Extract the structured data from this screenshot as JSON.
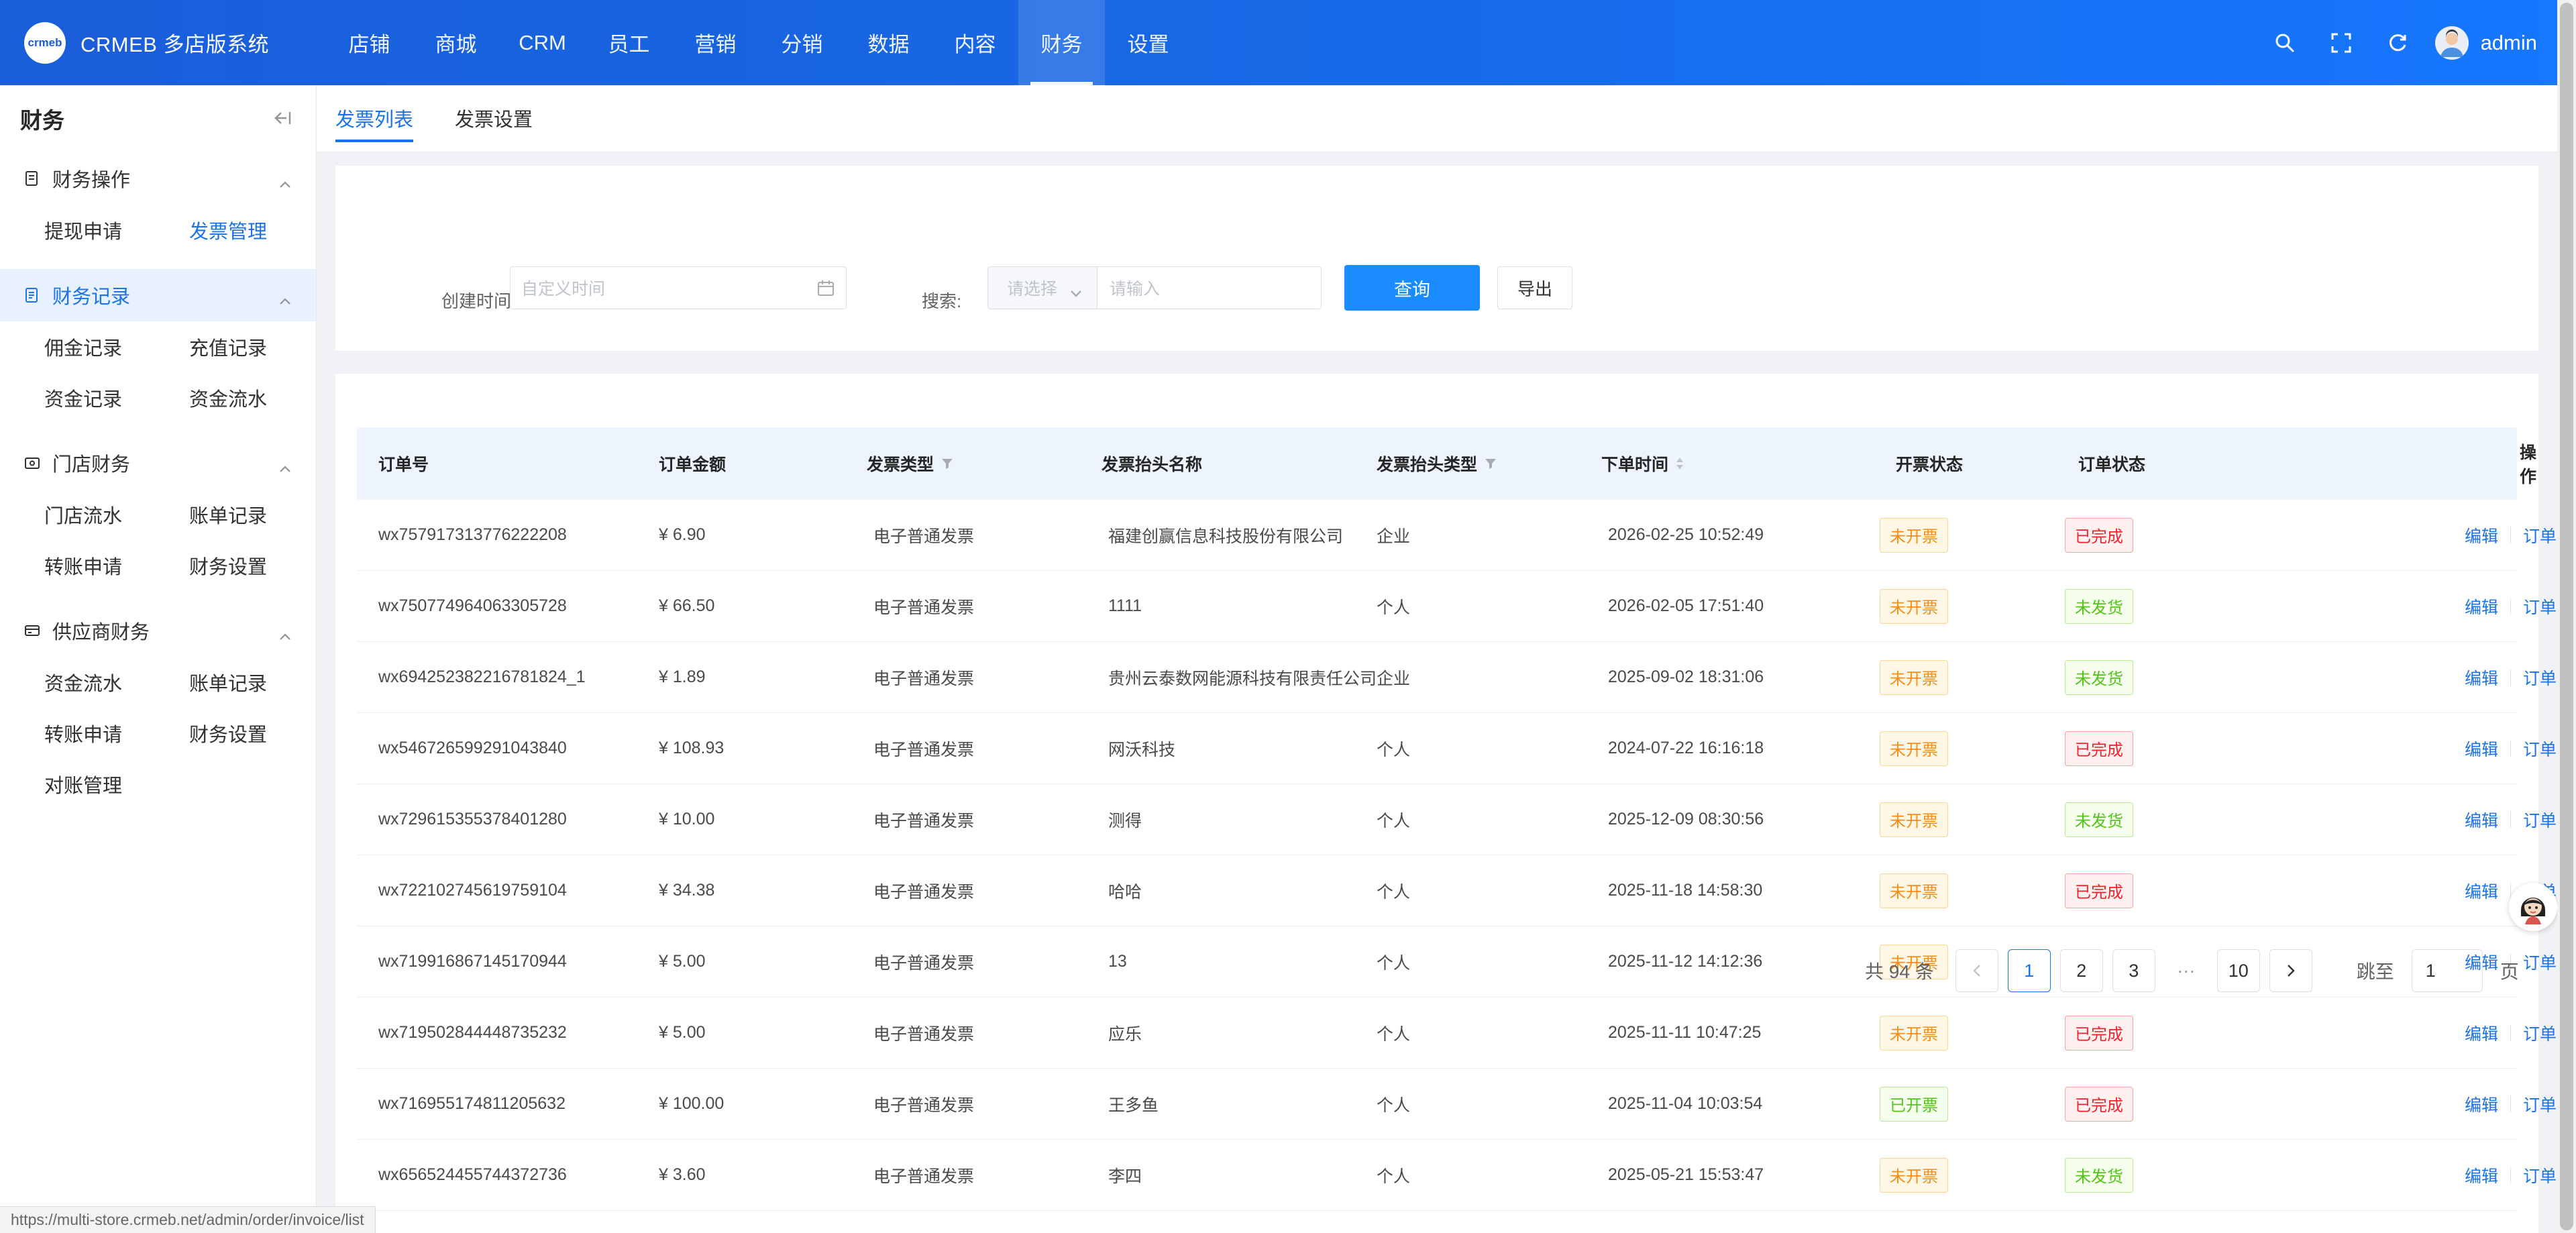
{
  "colors": {
    "header": "#1a5dd9",
    "primary": "#1a73e8",
    "accent_button": "#1a8cff"
  },
  "header": {
    "logo_badge": "crmeb",
    "app_title": "CRMEB 多店版系统",
    "nav": [
      "店铺",
      "商城",
      "CRM",
      "员工",
      "营销",
      "分销",
      "数据",
      "内容",
      "财务",
      "设置"
    ],
    "active_nav": "财务",
    "user_name": "admin",
    "icons": [
      "search-icon",
      "fullscreen-icon",
      "refresh-icon"
    ]
  },
  "sidebar": {
    "title": "财务",
    "groups": [
      {
        "label": "财务操作",
        "icon": "document-icon",
        "items": [
          "提现申请",
          "发票管理"
        ]
      },
      {
        "label": "财务记录",
        "icon": "list-icon",
        "items": [
          "佣金记录",
          "充值记录",
          "资金记录",
          "资金流水"
        ]
      },
      {
        "label": "门店财务",
        "icon": "store-icon",
        "items": [
          "门店流水",
          "账单记录",
          "转账申请",
          "财务设置"
        ]
      },
      {
        "label": "供应商财务",
        "icon": "card-icon",
        "items": [
          "资金流水",
          "账单记录",
          "转账申请",
          "财务设置",
          "对账管理"
        ]
      }
    ],
    "active_item": "发票管理",
    "highlighted_group": "财务记录"
  },
  "tabs": [
    "发票列表",
    "发票设置"
  ],
  "active_tab": "发票列表",
  "filter": {
    "created_time_label": "创建时间:",
    "date_placeholder": "自定义时间",
    "search_label": "搜索:",
    "select_placeholder": "请选择",
    "keyword_placeholder": "请输入",
    "query_button": "查询",
    "export_button": "导出"
  },
  "table": {
    "columns": [
      "订单号",
      "订单金额",
      "发票类型",
      "发票抬头名称",
      "发票抬头类型",
      "下单时间",
      "开票状态",
      "订单状态",
      "操作"
    ],
    "rows": [
      {
        "order_no": "wx757917313776222208",
        "amount": "¥ 6.90",
        "invoice_type": "电子普通发票",
        "title_name": "福建创赢信息科技股份有限公司",
        "title_type": "企业",
        "time": "2026-02-25 10:52:49",
        "invoice_status": "未开票",
        "order_status": "已完成"
      },
      {
        "order_no": "wx750774964063305728",
        "amount": "¥ 66.50",
        "invoice_type": "电子普通发票",
        "title_name": "1111",
        "title_type": "个人",
        "time": "2026-02-05 17:51:40",
        "invoice_status": "未开票",
        "order_status": "未发货"
      },
      {
        "order_no": "wx694252382216781824_1",
        "amount": "¥ 1.89",
        "invoice_type": "电子普通发票",
        "title_name": "贵州云泰数网能源科技有限责任公司",
        "title_type": "企业",
        "time": "2025-09-02 18:31:06",
        "invoice_status": "未开票",
        "order_status": "未发货"
      },
      {
        "order_no": "wx546726599291043840",
        "amount": "¥ 108.93",
        "invoice_type": "电子普通发票",
        "title_name": "网沃科技",
        "title_type": "个人",
        "time": "2024-07-22 16:16:18",
        "invoice_status": "未开票",
        "order_status": "已完成"
      },
      {
        "order_no": "wx729615355378401280",
        "amount": "¥ 10.00",
        "invoice_type": "电子普通发票",
        "title_name": "测得",
        "title_type": "个人",
        "time": "2025-12-09 08:30:56",
        "invoice_status": "未开票",
        "order_status": "未发货"
      },
      {
        "order_no": "wx722102745619759104",
        "amount": "¥ 34.38",
        "invoice_type": "电子普通发票",
        "title_name": "哈哈",
        "title_type": "个人",
        "time": "2025-11-18 14:58:30",
        "invoice_status": "未开票",
        "order_status": "已完成"
      },
      {
        "order_no": "wx719916867145170944",
        "amount": "¥ 5.00",
        "invoice_type": "电子普通发票",
        "title_name": "13",
        "title_type": "个人",
        "time": "2025-11-12 14:12:36",
        "invoice_status": "未开票",
        "order_status": ""
      },
      {
        "order_no": "wx719502844448735232",
        "amount": "¥ 5.00",
        "invoice_type": "电子普通发票",
        "title_name": "应乐",
        "title_type": "个人",
        "time": "2025-11-11 10:47:25",
        "invoice_status": "未开票",
        "order_status": "已完成"
      },
      {
        "order_no": "wx716955174811205632",
        "amount": "¥ 100.00",
        "invoice_type": "电子普通发票",
        "title_name": "王多鱼",
        "title_type": "个人",
        "time": "2025-11-04 10:03:54",
        "invoice_status": "已开票",
        "order_status": "已完成"
      },
      {
        "order_no": "wx656524455744372736",
        "amount": "¥ 3.60",
        "invoice_type": "电子普通发票",
        "title_name": "李四",
        "title_type": "个人",
        "time": "2025-05-21 15:53:47",
        "invoice_status": "未开票",
        "order_status": "未发货"
      }
    ],
    "actions": [
      "编辑",
      "订单信息"
    ]
  },
  "pagination": {
    "total_text": "共 94 条",
    "pages": [
      "1",
      "2",
      "3",
      "···",
      "10"
    ],
    "current": "1",
    "jump_label": "跳至",
    "jump_value": "1",
    "page_suffix": "页"
  },
  "status_url": "https://multi-store.crmeb.net/admin/order/invoice/list"
}
